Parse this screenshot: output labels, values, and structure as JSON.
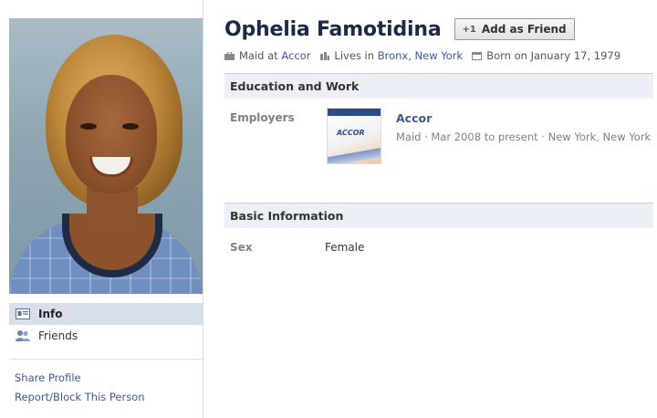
{
  "profile": {
    "name": "Ophelia Famotidina",
    "add_friend_label": "Add as Friend",
    "add_friend_prefix": "+1",
    "work_prefix": "Maid at",
    "work_place": "Accor",
    "lives_prefix": "Lives in",
    "lives_city": "Bronx",
    "lives_separator": ",",
    "lives_state": "New York",
    "born": "Born on January 17, 1979"
  },
  "left_nav": {
    "items": [
      {
        "label": "Info",
        "icon": "info-icon",
        "active": true
      },
      {
        "label": "Friends",
        "icon": "friends-icon",
        "active": false
      }
    ],
    "links": [
      {
        "label": "Share Profile"
      },
      {
        "label": "Report/Block This Person"
      }
    ]
  },
  "education_work": {
    "header": "Education and Work",
    "employers_label": "Employers",
    "employer": {
      "name": "Accor",
      "detail": "Maid · Mar 2008 to present · New York, New York",
      "logo_text": "ACCOR"
    }
  },
  "basic_information": {
    "header": "Basic Information",
    "rows": [
      {
        "label": "Sex",
        "value": "Female"
      }
    ]
  },
  "colors": {
    "link": "#3b5998",
    "name": "#1c2a47",
    "section_bg": "#eceff5",
    "active_nav_bg": "#d8dfea"
  }
}
